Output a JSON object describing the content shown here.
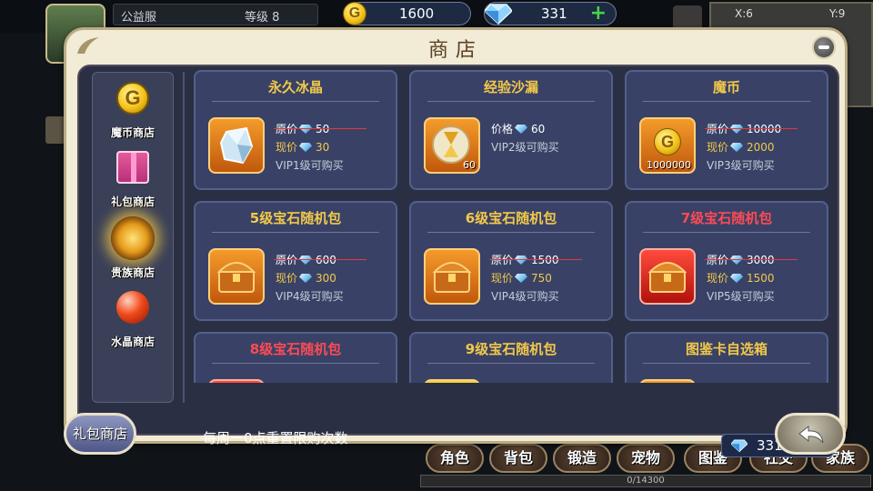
{
  "hud": {
    "server_name": "公益服",
    "level_text": "等级 8",
    "gold": "1600",
    "gems": "331",
    "coords_x": "X:6",
    "coords_y": "Y:9"
  },
  "shop": {
    "title": "商店",
    "tabs": [
      {
        "label": "魔币商店",
        "icon": "gold-coin-icon"
      },
      {
        "label": "礼包商店",
        "icon": "gift-box-icon"
      },
      {
        "label": "贵族商店",
        "icon": "crown-icon",
        "selected": true
      },
      {
        "label": "水晶商店",
        "icon": "crystal-orb-icon"
      }
    ],
    "price_label": "原价",
    "current_label": "现价",
    "single_price_label": "价格",
    "items": [
      {
        "name": "永久冰晶",
        "original": "50",
        "current": "30",
        "vip": "VIP1级可购买",
        "icon": "ice-crystal-icon"
      },
      {
        "name": "经验沙漏",
        "price": "60",
        "vip": "VIP2级可购买",
        "icon": "hourglass-icon",
        "qty": "60"
      },
      {
        "name": "魔币",
        "original": "10000",
        "current": "2000",
        "vip": "VIP3级可购买",
        "icon": "gold-coin-icon",
        "qty": "1000000"
      },
      {
        "name": "5级宝石随机包",
        "original": "600",
        "current": "300",
        "vip": "VIP4级可购买",
        "icon": "treasure-chest-icon"
      },
      {
        "name": "6级宝石随机包",
        "original": "1500",
        "current": "750",
        "vip": "VIP4级可购买",
        "icon": "treasure-chest-icon"
      },
      {
        "name": "7级宝石随机包",
        "original": "3000",
        "current": "1500",
        "vip": "VIP5级可购买",
        "icon": "treasure-chest-icon"
      },
      {
        "name": "8级宝石随机包"
      },
      {
        "name": "9级宝石随机包"
      },
      {
        "name": "图鉴卡自选箱"
      }
    ],
    "footer_note": "每周一0点重置限购次数",
    "footer_gems": "331",
    "bottom_tab_label": "礼包商店"
  },
  "bottom_menu": {
    "items": [
      "角色",
      "背包",
      "锻造",
      "宠物",
      "图鉴",
      "社交",
      "家族"
    ],
    "progress_text": "0/14300",
    "progress": 0
  },
  "colors": {
    "accent_gold": "#f2c84b",
    "rare_red": "#ff4a55",
    "panel_bg": "#2a2f44"
  }
}
